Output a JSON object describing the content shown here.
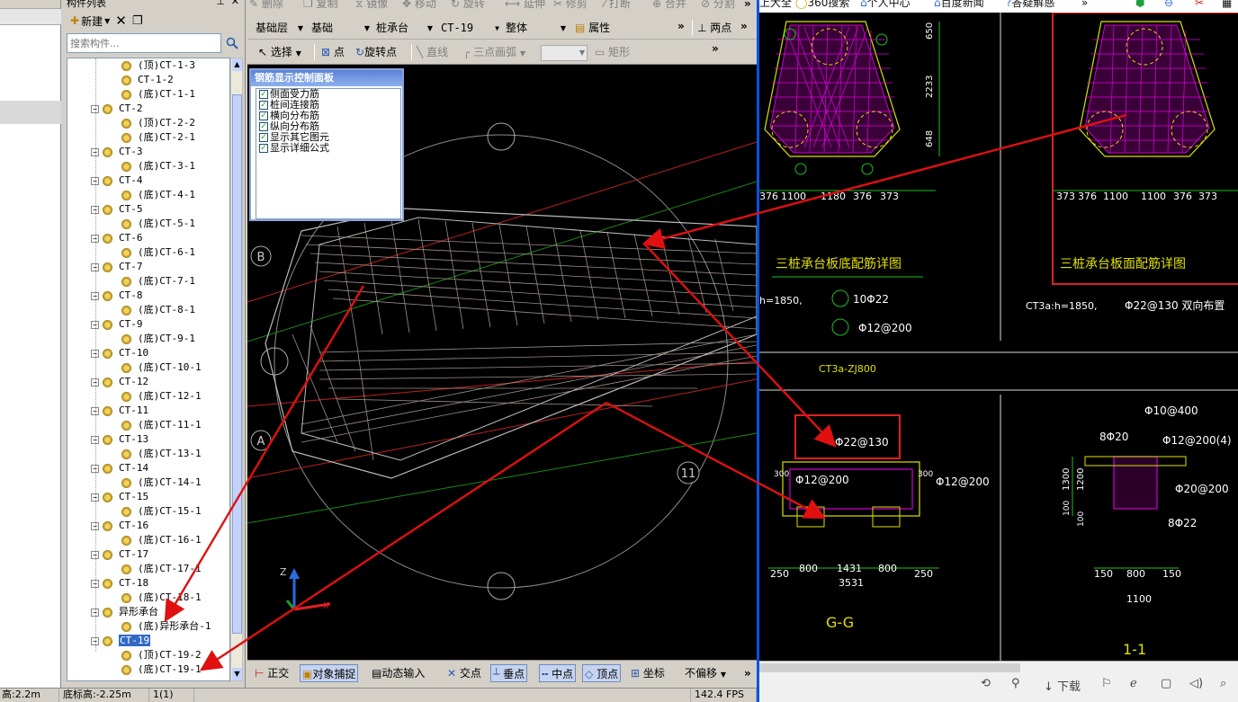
{
  "component_panel": {
    "title": "构件列表",
    "new_label": "新建",
    "search_placeholder": "搜索构件...",
    "tree": [
      {
        "label": "(顶)CT-1-3",
        "level": 2
      },
      {
        "label": "CT-1-2",
        "level": 2
      },
      {
        "label": "(底)CT-1-1",
        "level": 2
      },
      {
        "label": "CT-2",
        "level": 1
      },
      {
        "label": "(顶)CT-2-2",
        "level": 2
      },
      {
        "label": "(底)CT-2-1",
        "level": 2
      },
      {
        "label": "CT-3",
        "level": 1
      },
      {
        "label": "(底)CT-3-1",
        "level": 2
      },
      {
        "label": "CT-4",
        "level": 1
      },
      {
        "label": "(底)CT-4-1",
        "level": 2
      },
      {
        "label": "CT-5",
        "level": 1
      },
      {
        "label": "(底)CT-5-1",
        "level": 2
      },
      {
        "label": "CT-6",
        "level": 1
      },
      {
        "label": "(底)CT-6-1",
        "level": 2
      },
      {
        "label": "CT-7",
        "level": 1
      },
      {
        "label": "(底)CT-7-1",
        "level": 2
      },
      {
        "label": "CT-8",
        "level": 1
      },
      {
        "label": "(底)CT-8-1",
        "level": 2
      },
      {
        "label": "CT-9",
        "level": 1
      },
      {
        "label": "(底)CT-9-1",
        "level": 2
      },
      {
        "label": "CT-10",
        "level": 1
      },
      {
        "label": "(底)CT-10-1",
        "level": 2
      },
      {
        "label": "CT-12",
        "level": 1
      },
      {
        "label": "(底)CT-12-1",
        "level": 2
      },
      {
        "label": "CT-11",
        "level": 1
      },
      {
        "label": "(底)CT-11-1",
        "level": 2
      },
      {
        "label": "CT-13",
        "level": 1
      },
      {
        "label": "(底)CT-13-1",
        "level": 2
      },
      {
        "label": "CT-14",
        "level": 1
      },
      {
        "label": "(底)CT-14-1",
        "level": 2
      },
      {
        "label": "CT-15",
        "level": 1
      },
      {
        "label": "(底)CT-15-1",
        "level": 2
      },
      {
        "label": "CT-16",
        "level": 1
      },
      {
        "label": "(底)CT-16-1",
        "level": 2
      },
      {
        "label": "CT-17",
        "level": 1
      },
      {
        "label": "(底)CT-17-1",
        "level": 2
      },
      {
        "label": "CT-18",
        "level": 1
      },
      {
        "label": "(底)CT-18-1",
        "level": 2
      },
      {
        "label": "异形承台",
        "level": 1
      },
      {
        "label": "(底)异形承台-1",
        "level": 2
      },
      {
        "label": "CT-19",
        "level": 1,
        "selected": true
      },
      {
        "label": "(顶)CT-19-2",
        "level": 2
      },
      {
        "label": "(底)CT-19-1",
        "level": 2
      }
    ]
  },
  "cad_toolbar": {
    "row1": [
      "删除",
      "复制",
      "镜像",
      "移动",
      "旋转",
      "延伸",
      "修剪",
      "打断",
      "合并",
      "分割"
    ],
    "floor": "基础层",
    "category": "基础",
    "type": "桩承台",
    "component": "CT-19",
    "whole": "整体",
    "properties": "属性",
    "two_points": "两点",
    "select": "选择",
    "point": "点",
    "rotate_point": "旋转点",
    "line": "直线",
    "three_point_arc": "三点画弧",
    "rect": "矩形"
  },
  "rebar_panel": {
    "title": "钢筋显示控制面板",
    "items": [
      "侧面受力筋",
      "桩间连接筋",
      "横向分布筋",
      "纵向分布筋",
      "显示其它图元",
      "显示详细公式"
    ]
  },
  "cad_view": {
    "axis_labels": [
      "B",
      "A",
      "11"
    ],
    "axis_z": "Z",
    "axis_x": "X"
  },
  "cad_status": {
    "ortho": "正交",
    "snap": "对象捕捉",
    "dyn_input": "动态输入",
    "intersect": "交点",
    "perp": "垂点",
    "mid": "中点",
    "vertex": "顶点",
    "coord": "坐标",
    "offset": "不偏移"
  },
  "app_status": {
    "height": "高:2.2m",
    "bottom_height": "底标高:-2.25m",
    "count": "1(1)",
    "fps": "142.4 FPS"
  },
  "viewer": {
    "tabbar": [
      "上大全",
      "360搜索",
      "个人中心",
      "百度新闻",
      "答疑解惑"
    ],
    "bottom_download": "下载",
    "drawing": {
      "title1": "三桩承台板底配筋详图",
      "title2": "三桩承台板面配筋详图",
      "dims1": [
        "376",
        "1100",
        "1180",
        "376",
        "373"
      ],
      "dims2": [
        "373",
        "376",
        "1100",
        "1100",
        "376",
        "373"
      ],
      "vdims": [
        "650",
        "2233",
        "648"
      ],
      "h1": "h=1850,",
      "h2": "CT3a:h=1850,",
      "rebar1": "10Φ22",
      "rebar2": "Φ12@200",
      "rebar3": "Φ22@130 双向布置",
      "section_name": "CT3a-ZJ800",
      "gg": {
        "top": "Φ22@130",
        "side": "Φ12@200",
        "side2": "Φ12@200",
        "dims": [
          "250",
          "800",
          "1431",
          "800",
          "250"
        ],
        "total": "3531",
        "label": "G-G",
        "h300": "300",
        "h300b": "300"
      },
      "s11": {
        "top": "Φ10@400",
        "a": "8Φ20",
        "b": "Φ12@200(4)",
        "c": "Φ20@200",
        "d": "8Φ22",
        "dims": [
          "150",
          "800",
          "150"
        ],
        "total": "1100",
        "v1": "1300",
        "v2": "1200",
        "v3": "100",
        "v4": "100",
        "label": "1-1"
      }
    }
  }
}
